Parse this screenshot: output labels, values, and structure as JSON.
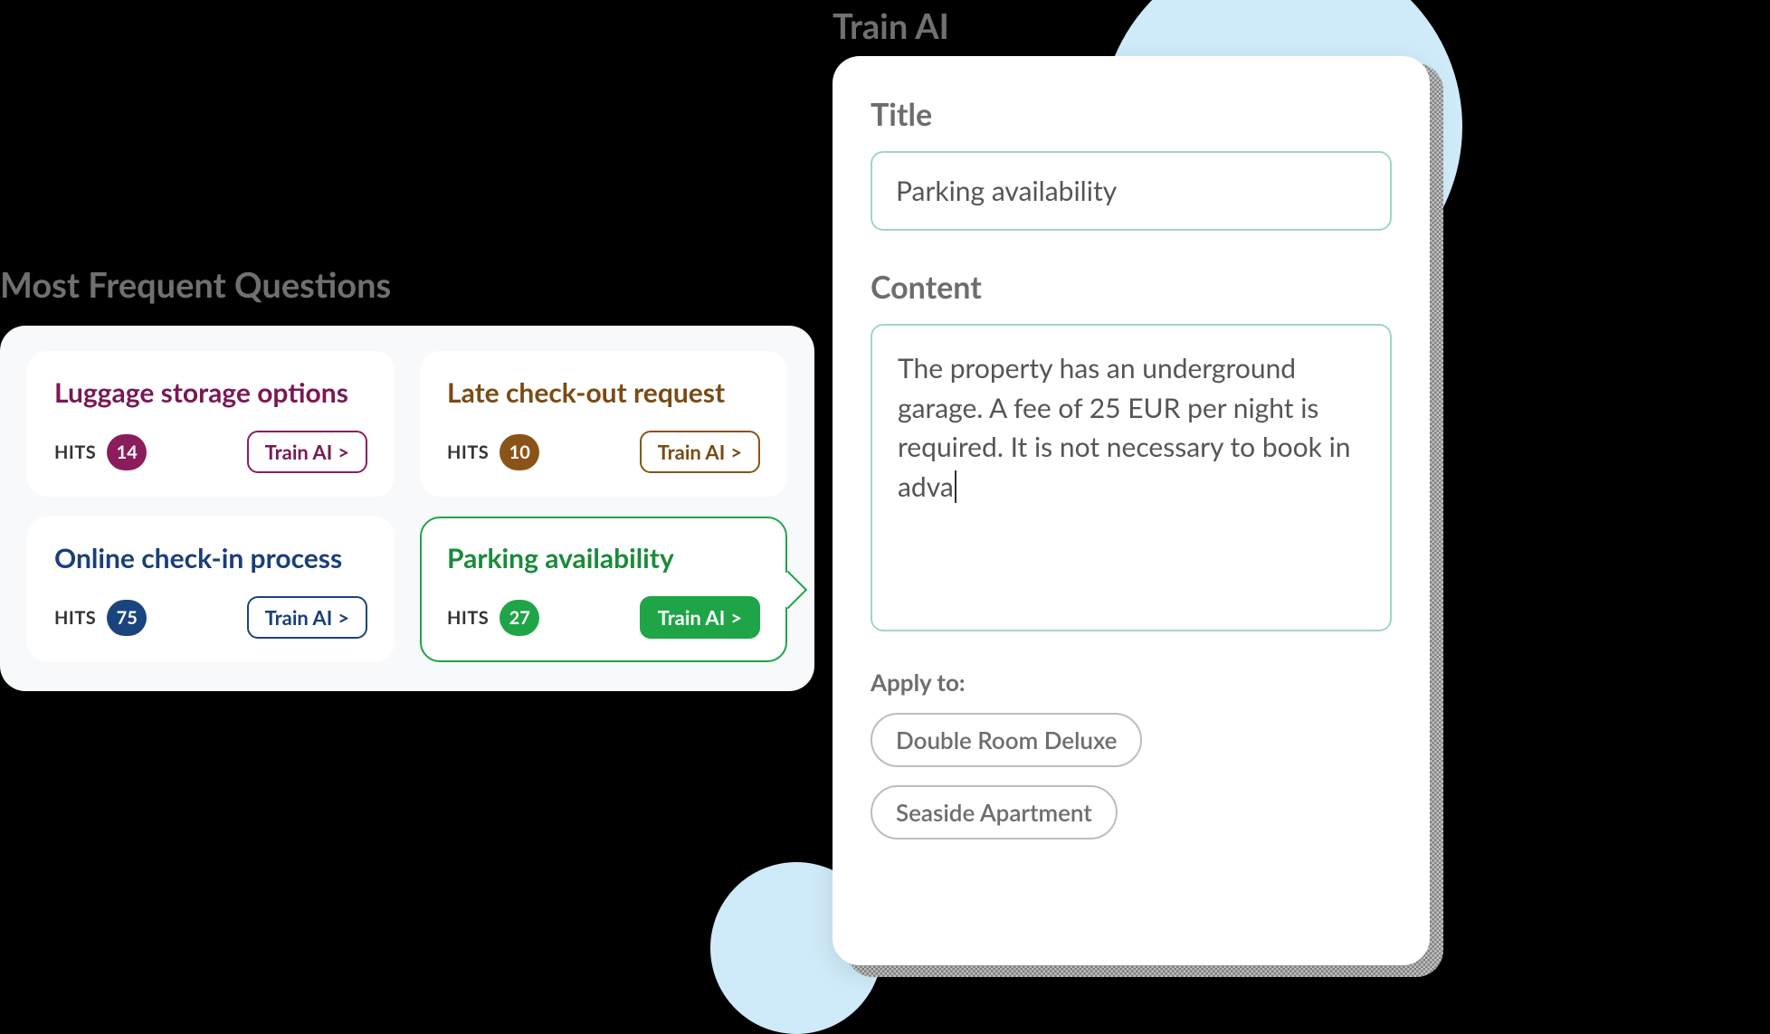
{
  "left": {
    "heading": "Most Frequent Questions",
    "hits_label": "HITS",
    "train_label": "Train AI",
    "train_caret": ">",
    "cards": [
      {
        "title": "Luggage storage options",
        "hits": "14",
        "color": "purple",
        "active": false
      },
      {
        "title": "Late check-out request",
        "hits": "10",
        "color": "brown",
        "active": false
      },
      {
        "title": "Online check-in process",
        "hits": "75",
        "color": "blue",
        "active": false
      },
      {
        "title": "Parking availability",
        "hits": "27",
        "color": "green",
        "active": true
      }
    ]
  },
  "right": {
    "heading": "Train AI",
    "title_label": "Title",
    "title_value": "Parking availability",
    "content_label": "Content",
    "content_value": "The property has an underground garage. A fee of 25 EUR per night is required. It is not necessary to book in adva",
    "apply_label": "Apply to:",
    "apply_chips": [
      "Double Room Deluxe",
      "Seaside Apartment"
    ]
  }
}
